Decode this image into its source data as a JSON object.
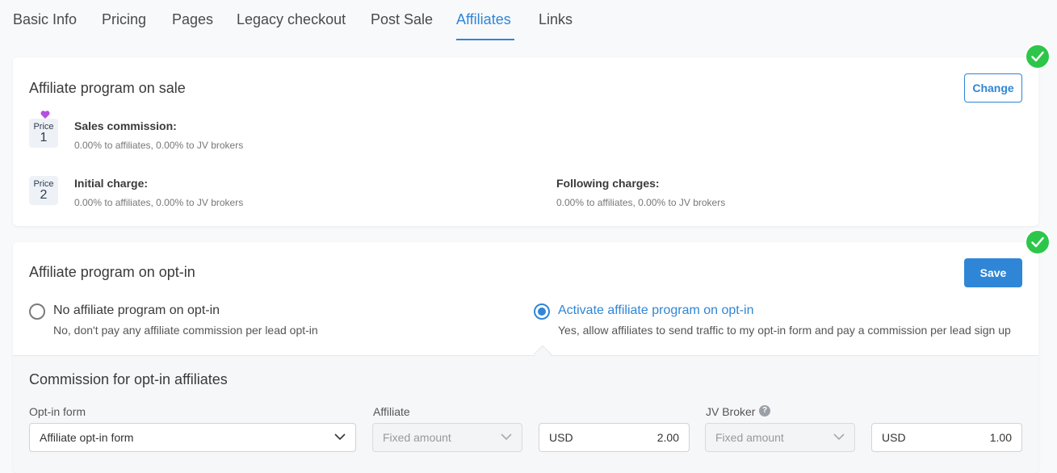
{
  "tabs": [
    {
      "label": "Basic Info"
    },
    {
      "label": "Pricing"
    },
    {
      "label": "Pages"
    },
    {
      "label": "Legacy checkout"
    },
    {
      "label": "Post Sale"
    },
    {
      "label": "Affiliates"
    },
    {
      "label": "Links"
    }
  ],
  "active_tab": "Affiliates",
  "sale": {
    "title": "Affiliate program on sale",
    "change_label": "Change",
    "price1": {
      "badge_label": "Price",
      "badge_number": "1",
      "label": "Sales commission:",
      "sub": "0.00% to affiliates, 0.00% to JV brokers"
    },
    "price2": {
      "badge_label": "Price",
      "badge_number": "2",
      "initial_label": "Initial charge:",
      "initial_sub": "0.00% to affiliates, 0.00% to JV brokers",
      "following_label": "Following charges:",
      "following_sub": "0.00% to affiliates, 0.00% to JV brokers"
    }
  },
  "optin": {
    "title": "Affiliate program on opt-in",
    "save_label": "Save",
    "option_none": {
      "title": "No affiliate program on opt-in",
      "sub": "No, don't pay any affiliate commission per lead opt-in"
    },
    "option_activate": {
      "title": "Activate affiliate program on opt-in",
      "sub": "Yes, allow affiliates to send traffic to my opt-in form and pay a commission per lead sign up"
    },
    "commission": {
      "title": "Commission for opt-in affiliates",
      "optin_form_label": "Opt-in form",
      "optin_form_value": "Affiliate opt-in form",
      "affiliate_label": "Affiliate",
      "affiliate_type": "Fixed amount",
      "affiliate_currency": "USD",
      "affiliate_amount": "2.00",
      "jv_label": "JV Broker",
      "jv_help": "?",
      "jv_type": "Fixed amount",
      "jv_currency": "USD",
      "jv_amount": "1.00"
    }
  },
  "colors": {
    "accent": "#2f86d6",
    "success": "#2ec64a",
    "heart": "#b44fe0"
  }
}
